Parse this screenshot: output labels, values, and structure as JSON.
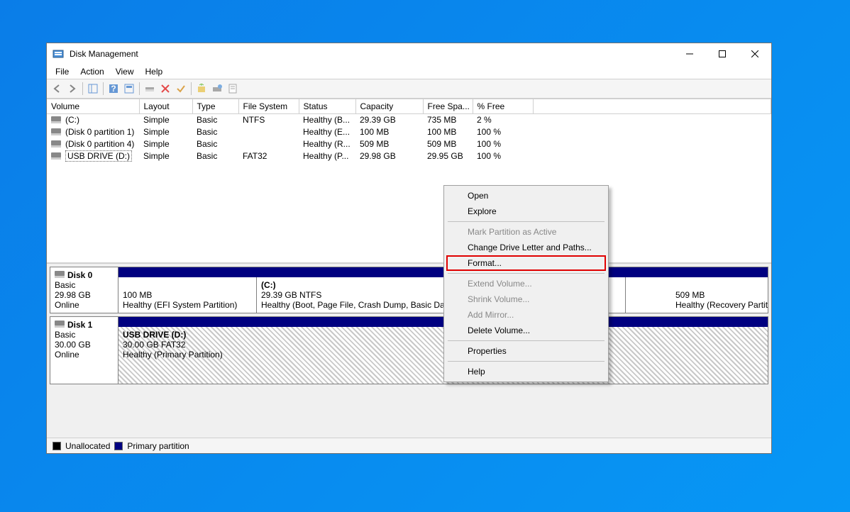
{
  "window": {
    "title": "Disk Management"
  },
  "menus": {
    "file": "File",
    "action": "Action",
    "view": "View",
    "help": "Help"
  },
  "columns": {
    "volume": "Volume",
    "layout": "Layout",
    "type": "Type",
    "fs": "File System",
    "status": "Status",
    "capacity": "Capacity",
    "free": "Free Spa...",
    "pct": "% Free"
  },
  "rows": {
    "r0": {
      "vol": "(C:)",
      "layout": "Simple",
      "type": "Basic",
      "fs": "NTFS",
      "status": "Healthy (B...",
      "cap": "29.39 GB",
      "free": "735 MB",
      "pct": "2 %"
    },
    "r1": {
      "vol": "(Disk 0 partition 1)",
      "layout": "Simple",
      "type": "Basic",
      "fs": "",
      "status": "Healthy (E...",
      "cap": "100 MB",
      "free": "100 MB",
      "pct": "100 %"
    },
    "r2": {
      "vol": "(Disk 0 partition 4)",
      "layout": "Simple",
      "type": "Basic",
      "fs": "",
      "status": "Healthy (R...",
      "cap": "509 MB",
      "free": "509 MB",
      "pct": "100 %"
    },
    "r3": {
      "vol": "USB DRIVE (D:)",
      "layout": "Simple",
      "type": "Basic",
      "fs": "FAT32",
      "status": "Healthy (P...",
      "cap": "29.98 GB",
      "free": "29.95 GB",
      "pct": "100 %"
    }
  },
  "disk0": {
    "name": "Disk 0",
    "type": "Basic",
    "size": "29.98 GB",
    "state": "Online",
    "p0": {
      "line1": "100 MB",
      "line2": "Healthy (EFI System Partition)"
    },
    "p1": {
      "name": "(C:)",
      "line1": "29.39 GB NTFS",
      "line2": "Healthy (Boot, Page File, Crash Dump, Basic Data Partition)"
    },
    "p2": {
      "line1": "509 MB",
      "line2": "Healthy (Recovery Partition)"
    }
  },
  "disk1": {
    "name": "Disk 1",
    "type": "Basic",
    "size": "30.00 GB",
    "state": "Online",
    "p0": {
      "name": "USB DRIVE  (D:)",
      "line1": "30.00 GB FAT32",
      "line2": "Healthy (Primary Partition)"
    }
  },
  "legend": {
    "unalloc": "Unallocated",
    "primary": "Primary partition"
  },
  "ctx": {
    "open": "Open",
    "explore": "Explore",
    "mark": "Mark Partition as Active",
    "change": "Change Drive Letter and Paths...",
    "format": "Format...",
    "extend": "Extend Volume...",
    "shrink": "Shrink Volume...",
    "mirror": "Add Mirror...",
    "delete": "Delete Volume...",
    "props": "Properties",
    "help": "Help"
  }
}
